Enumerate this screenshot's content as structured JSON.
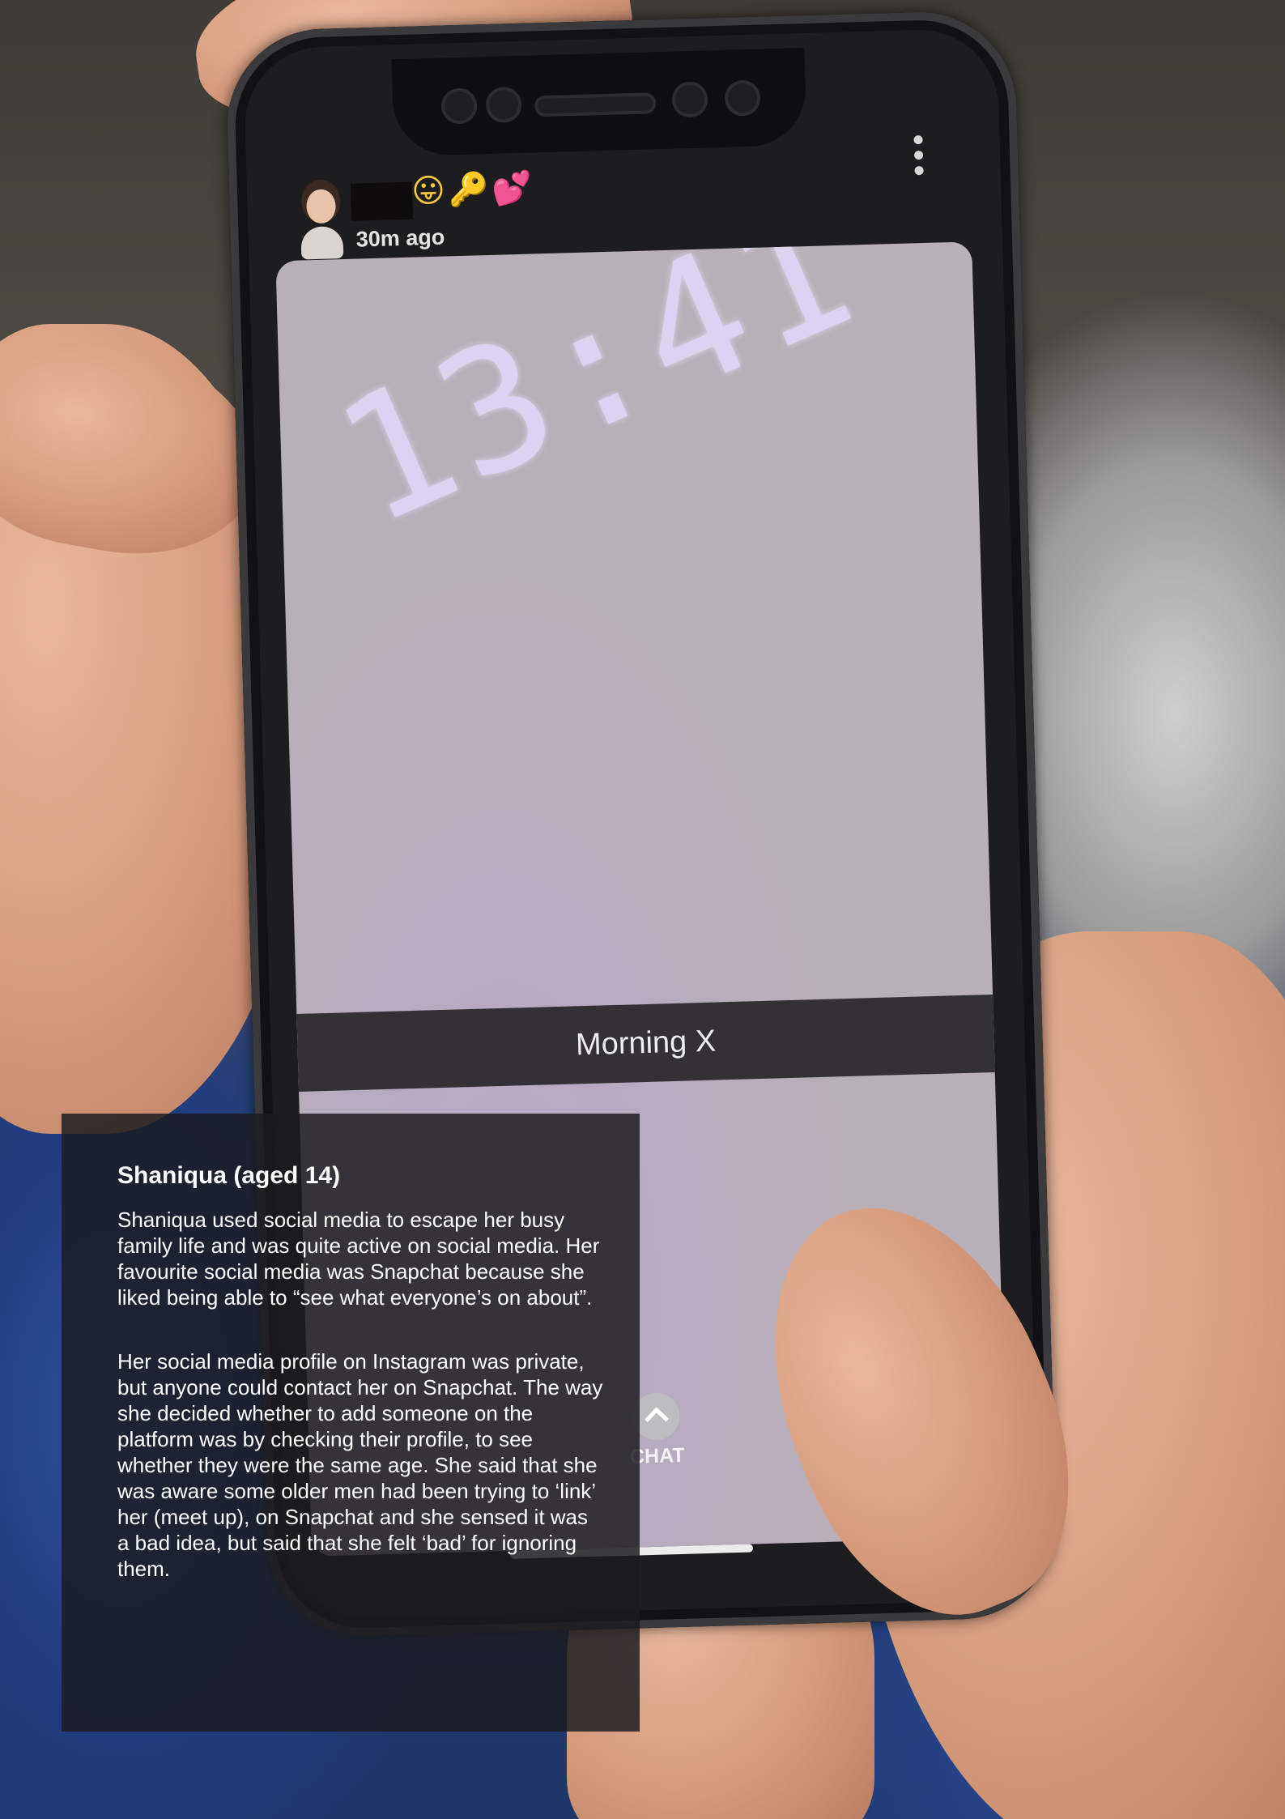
{
  "snap": {
    "time_ago": "30m ago",
    "emojis": "😛🔑💕",
    "clock_text": "13:41",
    "caption": "Morning X",
    "chat_label": "CHAT"
  },
  "case_study": {
    "title": "Shaniqua (aged 14)",
    "paragraph_1": "Shaniqua used social media to escape her busy family life and was quite active on social media. Her favourite social media was Snapchat because she liked being able to “see what everyone’s on about”.",
    "paragraph_2": "Her social media profile on Instagram was private, but anyone could contact her on Snapchat. The way she decided whether to add someone on the platform was by checking their profile, to see whether they were the same age. She said that she was aware some older men had been trying to ‘link’ her (meet up), on Snapchat and she sensed it was a bad idea, but said that she felt ‘bad’ for ignoring them."
  },
  "icons": {
    "avatar": "bitmoji-avatar-icon",
    "menu": "vertical-dots-menu-icon",
    "chat": "chevron-up-icon"
  }
}
